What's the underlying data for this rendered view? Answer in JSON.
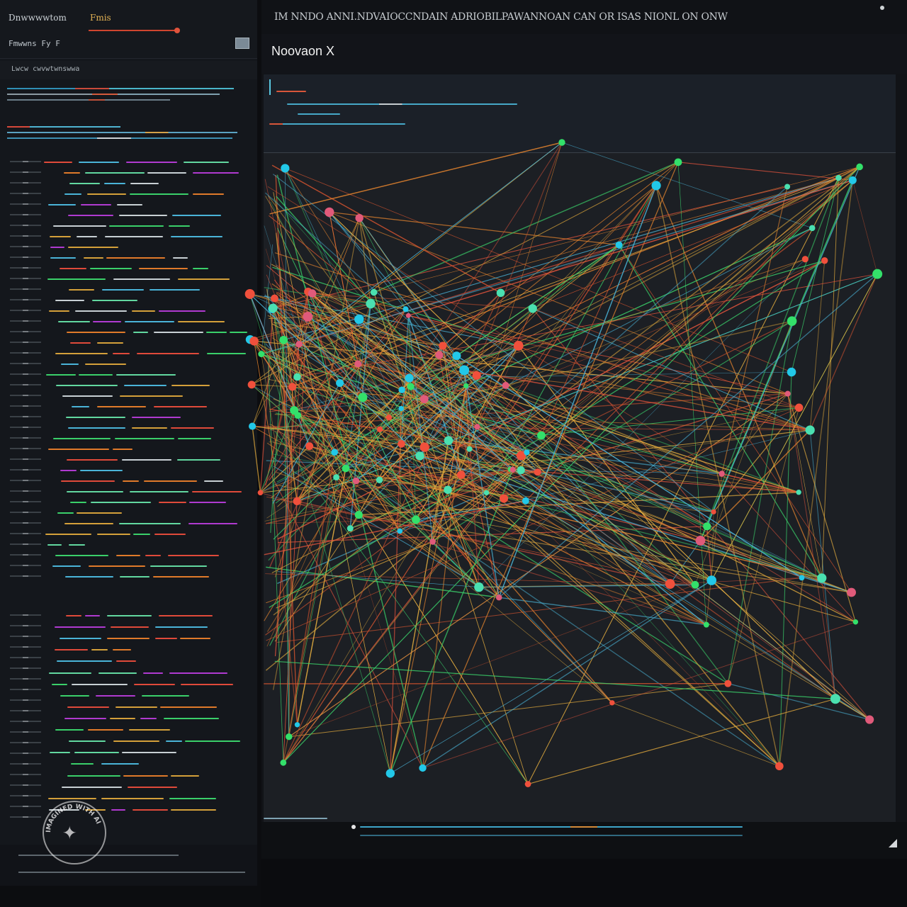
{
  "left_panel": {
    "title": "Dnwwwwtom",
    "tab_label": "Fmis",
    "subtitle": "Fmwwns Fy F",
    "breadcrumb": "Lwcw cwvwtwnswwa"
  },
  "header": {
    "caption": "IM NNDO ANNI.NDVAIOCCNDAIN ADRIOBILPAWANNOAN CAN OR ISAS NIONL ON ONW",
    "title": "Noovaon X"
  },
  "watermark": {
    "text": "IMAGINED WITH AI"
  },
  "colors": {
    "background": "#0c0d10",
    "panel": "#14171c",
    "canvas": "#1c1f24",
    "accent_orange": "#e0533c",
    "accent_yellow": "#e3b254",
    "node_green": "#33e06a",
    "node_cyan": "#22c8e8",
    "node_red": "#f0503c",
    "edge_orange": "#e8862e"
  },
  "icons": [
    "close-dot-icon",
    "resize-grip-icon",
    "panel-toggle-icon",
    "sparkle-watermark-icon"
  ]
}
